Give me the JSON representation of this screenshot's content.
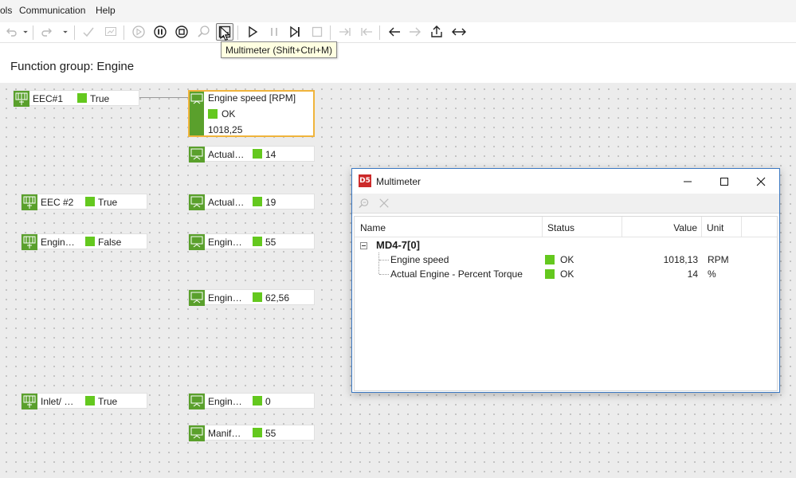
{
  "menu": {
    "items": [
      "ols",
      "Communication",
      "Help"
    ]
  },
  "toolbar": {
    "tooltip": "Multimeter (Shift+Ctrl+M)",
    "icons": [
      "undo-icon",
      "undo-dropdown-icon",
      "redo-icon",
      "redo-dropdown-icon",
      "check-icon",
      "compare-icon",
      "play-circle-icon",
      "pause-circle-icon",
      "stop-circle-icon",
      "zoom-icon",
      "multimeter-icon",
      "play-icon",
      "pause-icon",
      "step-icon",
      "stop-icon",
      "step-into-icon",
      "step-back-icon",
      "arrow-left-icon",
      "arrow-right-icon",
      "export-icon",
      "resize-horizontal-icon"
    ]
  },
  "group": {
    "title": "Function group: Engine"
  },
  "canvas": {
    "status_color": "#64c81e",
    "highlight_color": "#f0b43c",
    "left_nodes": [
      {
        "label": "EEC#1",
        "value": "True"
      },
      {
        "label": "EEC #2",
        "value": "True"
      },
      {
        "label": "Engin…",
        "value": "False"
      },
      {
        "label": "Inlet/ …",
        "value": "True"
      }
    ],
    "selected_node": {
      "title": "Engine speed [RPM]",
      "status": "OK",
      "value": "1018,25"
    },
    "right_nodes": [
      {
        "label": "Actual…",
        "value": "14"
      },
      {
        "label": "Actual…",
        "value": "19"
      },
      {
        "label": "Engin…",
        "value": "55"
      },
      {
        "label": "Engin…",
        "value": "62,56"
      },
      {
        "label": "Engin…",
        "value": "0"
      },
      {
        "label": "Manif…",
        "value": "55"
      }
    ]
  },
  "multimeter": {
    "app_icon": "D5",
    "title": "Multimeter",
    "columns": {
      "name": "Name",
      "status": "Status",
      "value": "Value",
      "unit": "Unit"
    },
    "group": "MD4-7[0]",
    "rows": [
      {
        "name": "Engine speed",
        "status": "OK",
        "value": "1018,13",
        "unit": "RPM"
      },
      {
        "name": "Actual Engine - Percent Torque",
        "status": "OK",
        "value": "14",
        "unit": "%"
      }
    ]
  }
}
